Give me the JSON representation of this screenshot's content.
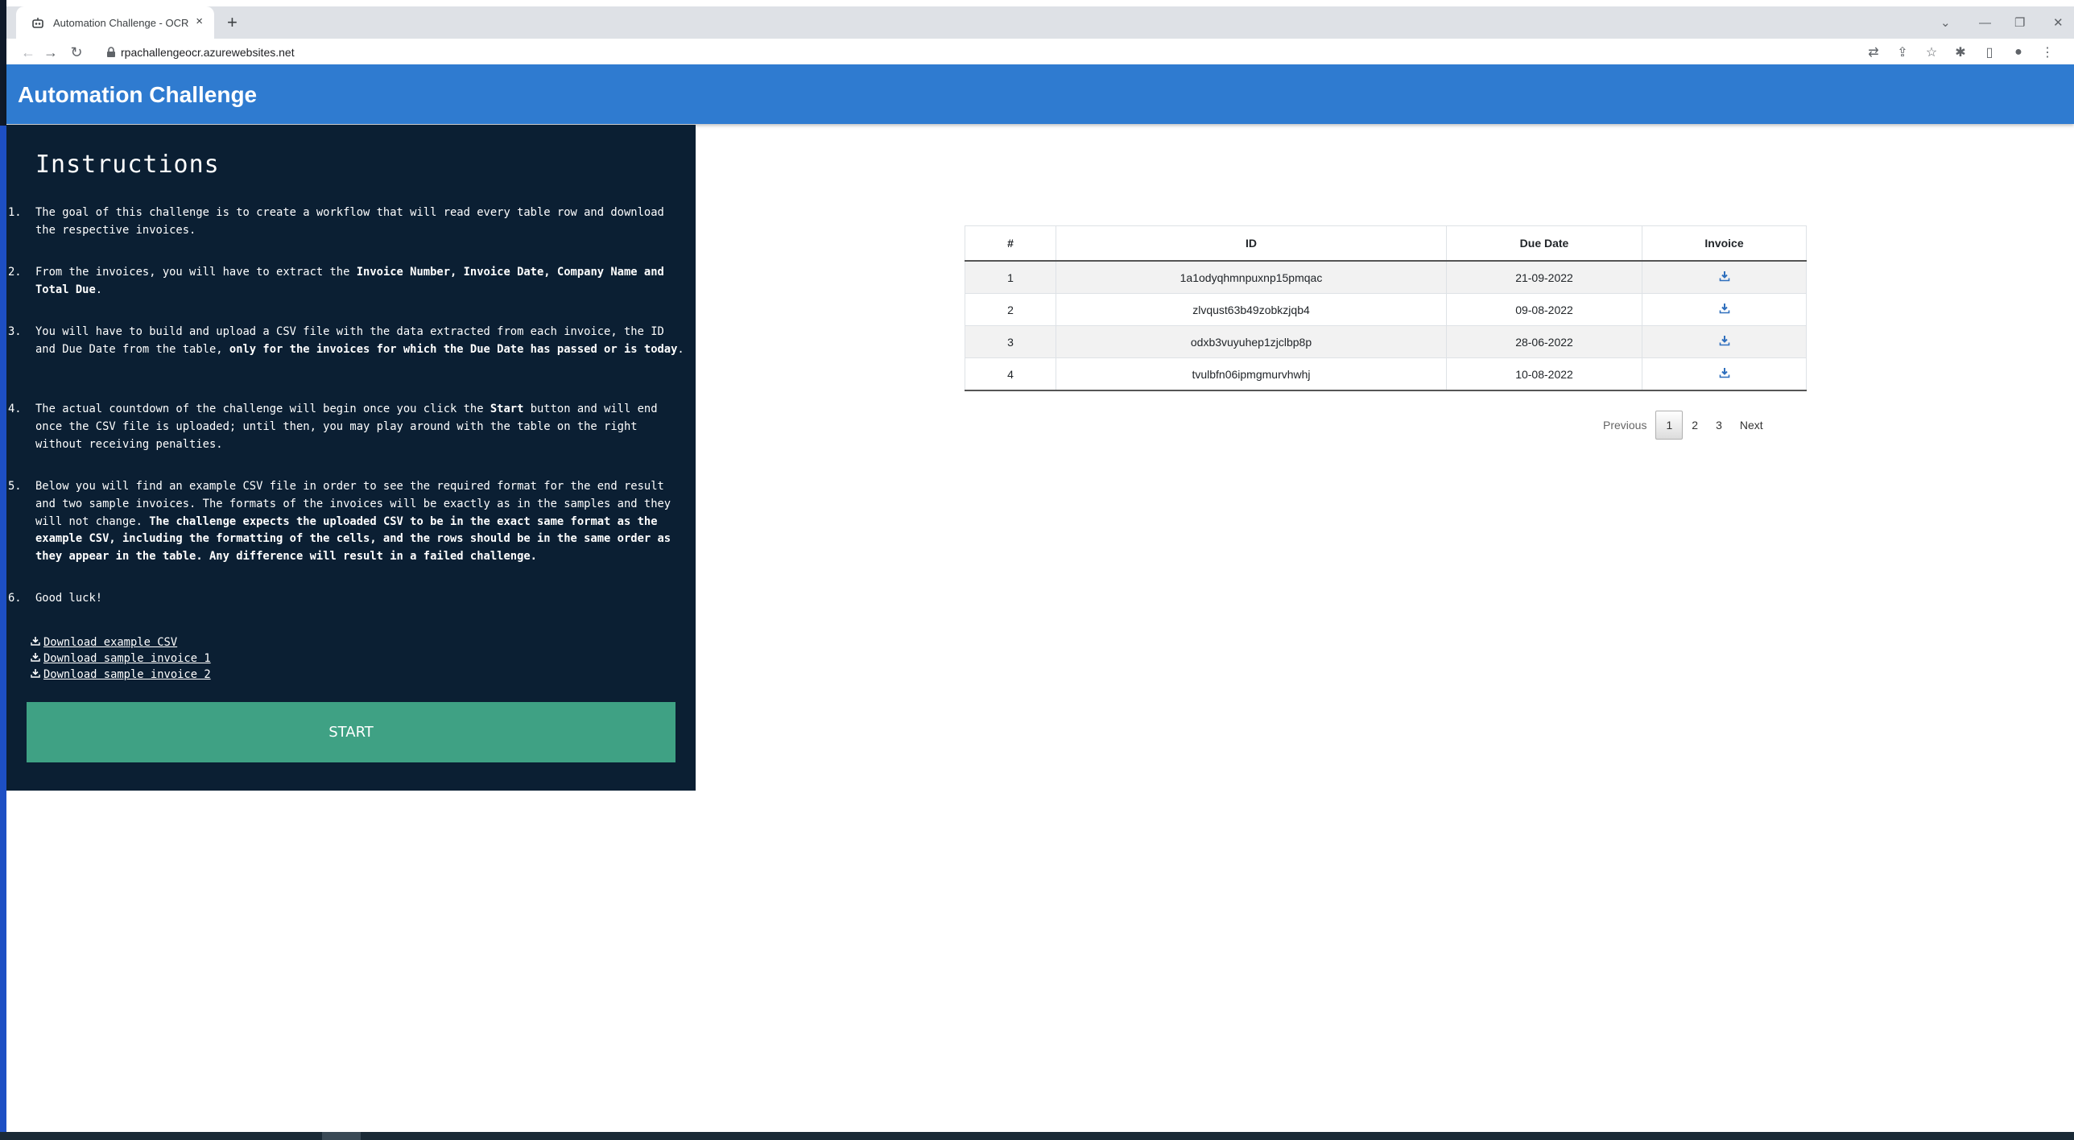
{
  "browser": {
    "tab_title": "Automation Challenge - OCR",
    "url": "rpachallengeocr.azurewebsites.net",
    "new_tab_label": "+",
    "tab_close": "×"
  },
  "app": {
    "title": "Automation Challenge"
  },
  "instructions": {
    "heading": "Instructions",
    "items": [
      {
        "num": "1.",
        "text": "The goal of this challenge is to create a workflow that will read every table row and download the respective invoices."
      },
      {
        "num": "2.",
        "pre": "From the invoices, you will have to extract the ",
        "bold": "Invoice Number, Invoice Date, Company Name and Total Due",
        "post": "."
      },
      {
        "num": "3.",
        "pre": "You will have to build and upload a CSV file with the data extracted from each invoice, the ID and Due Date from the table, ",
        "bold": "only for the invoices for which the Due Date has passed or is today",
        "post": "."
      },
      {
        "num": "4.",
        "pre": "The actual countdown of the challenge will begin once you click the ",
        "bold": "Start",
        "post": " button and will end once the CSV file is uploaded; until then, you may play around with the table on the right without receiving penalties."
      },
      {
        "num": "5.",
        "pre": "Below you will find an example CSV file in order to see the required format for the end result and two sample invoices. The formats of the invoices will be exactly as in the samples and they will not change. ",
        "bold": "The challenge expects the uploaded CSV to be in the exact same format as the example CSV, including the formatting of the cells, and the rows should be in the same order as they appear in the table. Any difference will result in a failed challenge.",
        "post": ""
      },
      {
        "num": "6.",
        "text": "Good luck!"
      }
    ],
    "links": [
      "Download example CSV",
      "Download sample invoice 1",
      "Download sample invoice 2"
    ],
    "start_label": "START"
  },
  "table": {
    "headers": [
      "#",
      "ID",
      "Due Date",
      "Invoice"
    ],
    "rows": [
      {
        "n": "1",
        "id": "1a1odyqhmnpuxnp15pmqac",
        "due": "21-09-2022"
      },
      {
        "n": "2",
        "id": "zlvqust63b49zobkzjqb4",
        "due": "09-08-2022"
      },
      {
        "n": "3",
        "id": "odxb3vuyuhep1zjclbp8p",
        "due": "28-06-2022"
      },
      {
        "n": "4",
        "id": "tvulbfn06ipmgmurvhwhj",
        "due": "10-08-2022"
      }
    ]
  },
  "pagination": {
    "previous": "Previous",
    "pages": [
      "1",
      "2",
      "3"
    ],
    "current": "1",
    "next": "Next"
  },
  "colors": {
    "header_blue": "#2f7bd0",
    "panel_navy": "#0b1f33",
    "start_green": "#3fa184"
  }
}
